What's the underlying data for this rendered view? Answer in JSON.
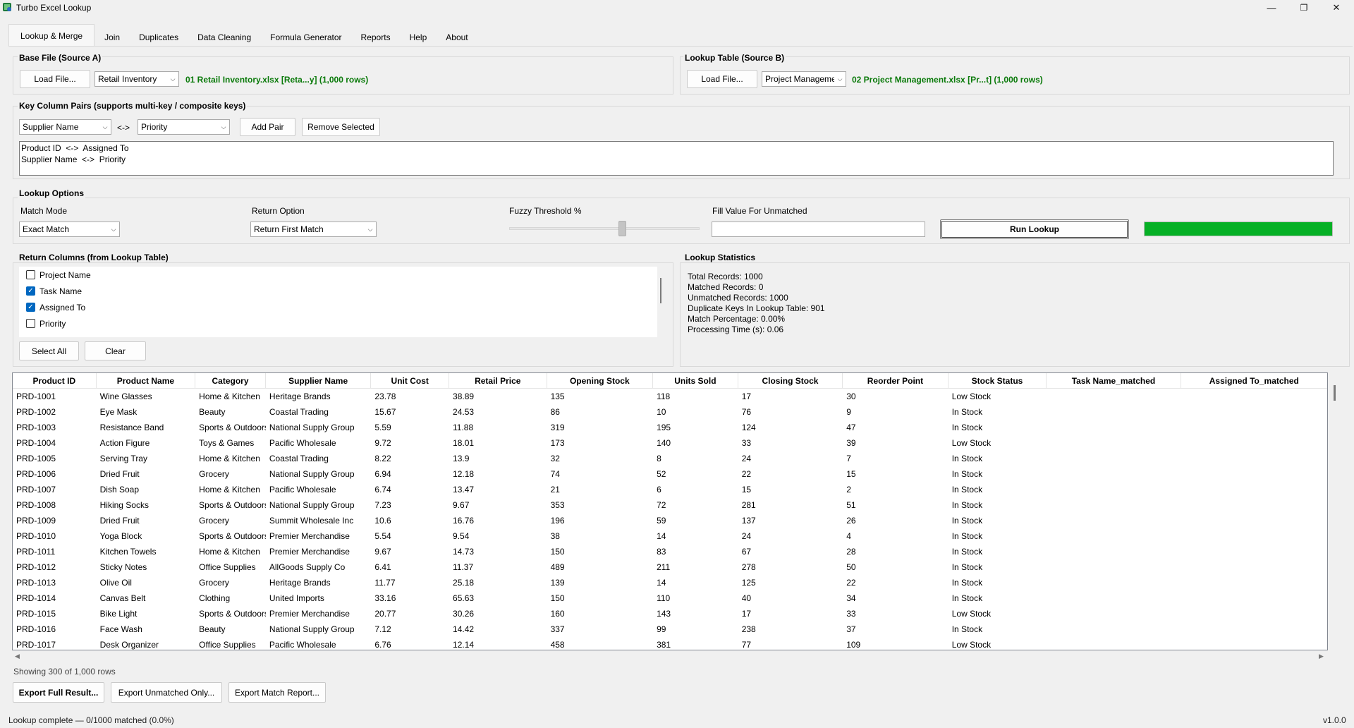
{
  "window": {
    "title": "Turbo Excel Lookup",
    "minimize": "—",
    "maximize": "❐",
    "close": "✕"
  },
  "tabs": [
    {
      "label": "Lookup & Merge",
      "active": true
    },
    {
      "label": "Join"
    },
    {
      "label": "Duplicates"
    },
    {
      "label": "Data Cleaning"
    },
    {
      "label": "Formula Generator"
    },
    {
      "label": "Reports"
    },
    {
      "label": "Help"
    },
    {
      "label": "About"
    }
  ],
  "base_file": {
    "title": "Base File (Source A)",
    "load_label": "Load File...",
    "sheet": "Retail Inventory",
    "file_info": "01 Retail Inventory.xlsx  [Reta...y]  (1,000 rows)"
  },
  "lookup_table": {
    "title": "Lookup Table (Source B)",
    "load_label": "Load File...",
    "sheet": "Project Management",
    "file_info": "02 Project Management.xlsx  [Pr...t]  (1,000 rows)"
  },
  "key_pairs": {
    "title": "Key Column Pairs  (supports multi-key / composite keys)",
    "left_col": "Supplier Name",
    "separator": "<->",
    "right_col": "Priority",
    "add_label": "Add Pair",
    "remove_label": "Remove Selected",
    "pairs": [
      "Product ID  <->  Assigned To",
      "Supplier Name  <->  Priority"
    ]
  },
  "options": {
    "title": "Lookup Options",
    "match_mode_label": "Match Mode",
    "match_mode": "Exact Match",
    "return_option_label": "Return Option",
    "return_option": "Return First Match",
    "fuzzy_label": "Fuzzy Threshold %",
    "fuzzy_value": 0.6,
    "fill_label": "Fill Value For Unmatched",
    "fill_value": "",
    "run_label": "Run Lookup",
    "progress": 1.0
  },
  "return_columns": {
    "title": "Return Columns (from Lookup Table)",
    "items": [
      {
        "label": "Project Name",
        "checked": false
      },
      {
        "label": "Task Name",
        "checked": true
      },
      {
        "label": "Assigned To",
        "checked": true
      },
      {
        "label": "Priority",
        "checked": false
      }
    ],
    "select_all_label": "Select All",
    "clear_label": "Clear"
  },
  "stats": {
    "title": "Lookup Statistics",
    "lines": [
      "Total Records: 1000",
      "Matched Records: 0",
      "Unmatched Records: 1000",
      "Duplicate Keys In Lookup Table: 901",
      "Match Percentage: 0.00%",
      "Processing Time (s): 0.06"
    ]
  },
  "table": {
    "columns": [
      "Product ID",
      "Product Name",
      "Category",
      "Supplier Name",
      "Unit Cost",
      "Retail Price",
      "Opening Stock",
      "Units Sold",
      "Closing Stock",
      "Reorder Point",
      "Stock Status",
      "Task Name_matched",
      "Assigned To_matched"
    ],
    "rows": [
      [
        "PRD-1001",
        "Wine Glasses",
        "Home & Kitchen",
        "Heritage Brands",
        "23.78",
        "38.89",
        "135",
        "118",
        "17",
        "30",
        "Low Stock",
        "",
        ""
      ],
      [
        "PRD-1002",
        "Eye Mask",
        "Beauty",
        "Coastal Trading",
        "15.67",
        "24.53",
        "86",
        "10",
        "76",
        "9",
        "In Stock",
        "",
        ""
      ],
      [
        "PRD-1003",
        "Resistance Band",
        "Sports & Outdoors",
        "National Supply Group",
        "5.59",
        "11.88",
        "319",
        "195",
        "124",
        "47",
        "In Stock",
        "",
        ""
      ],
      [
        "PRD-1004",
        "Action Figure",
        "Toys & Games",
        "Pacific Wholesale",
        "9.72",
        "18.01",
        "173",
        "140",
        "33",
        "39",
        "Low Stock",
        "",
        ""
      ],
      [
        "PRD-1005",
        "Serving Tray",
        "Home & Kitchen",
        "Coastal Trading",
        "8.22",
        "13.9",
        "32",
        "8",
        "24",
        "7",
        "In Stock",
        "",
        ""
      ],
      [
        "PRD-1006",
        "Dried Fruit",
        "Grocery",
        "National Supply Group",
        "6.94",
        "12.18",
        "74",
        "52",
        "22",
        "15",
        "In Stock",
        "",
        ""
      ],
      [
        "PRD-1007",
        "Dish Soap",
        "Home & Kitchen",
        "Pacific Wholesale",
        "6.74",
        "13.47",
        "21",
        "6",
        "15",
        "2",
        "In Stock",
        "",
        ""
      ],
      [
        "PRD-1008",
        "Hiking Socks",
        "Sports & Outdoors",
        "National Supply Group",
        "7.23",
        "9.67",
        "353",
        "72",
        "281",
        "51",
        "In Stock",
        "",
        ""
      ],
      [
        "PRD-1009",
        "Dried Fruit",
        "Grocery",
        "Summit Wholesale Inc",
        "10.6",
        "16.76",
        "196",
        "59",
        "137",
        "26",
        "In Stock",
        "",
        ""
      ],
      [
        "PRD-1010",
        "Yoga Block",
        "Sports & Outdoors",
        "Premier Merchandise",
        "5.54",
        "9.54",
        "38",
        "14",
        "24",
        "4",
        "In Stock",
        "",
        ""
      ],
      [
        "PRD-1011",
        "Kitchen Towels",
        "Home & Kitchen",
        "Premier Merchandise",
        "9.67",
        "14.73",
        "150",
        "83",
        "67",
        "28",
        "In Stock",
        "",
        ""
      ],
      [
        "PRD-1012",
        "Sticky Notes",
        "Office Supplies",
        "AllGoods Supply Co",
        "6.41",
        "11.37",
        "489",
        "211",
        "278",
        "50",
        "In Stock",
        "",
        ""
      ],
      [
        "PRD-1013",
        "Olive Oil",
        "Grocery",
        "Heritage Brands",
        "11.77",
        "25.18",
        "139",
        "14",
        "125",
        "22",
        "In Stock",
        "",
        ""
      ],
      [
        "PRD-1014",
        "Canvas Belt",
        "Clothing",
        "United Imports",
        "33.16",
        "65.63",
        "150",
        "110",
        "40",
        "34",
        "In Stock",
        "",
        ""
      ],
      [
        "PRD-1015",
        "Bike Light",
        "Sports & Outdoors",
        "Premier Merchandise",
        "20.77",
        "30.26",
        "160",
        "143",
        "17",
        "33",
        "Low Stock",
        "",
        ""
      ],
      [
        "PRD-1016",
        "Face Wash",
        "Beauty",
        "National Supply Group",
        "7.12",
        "14.42",
        "337",
        "99",
        "238",
        "37",
        "In Stock",
        "",
        ""
      ],
      [
        "PRD-1017",
        "Desk Organizer",
        "Office Supplies",
        "Pacific Wholesale",
        "6.76",
        "12.14",
        "458",
        "381",
        "77",
        "109",
        "Low Stock",
        "",
        ""
      ]
    ],
    "showing": "Showing 300 of 1,000 rows"
  },
  "exports": {
    "full": "Export Full Result...",
    "unmatched": "Export Unmatched Only...",
    "report": "Export Match Report..."
  },
  "status": {
    "text": "Lookup complete — 0/1000 matched (0.0%)",
    "version": "v1.0.0"
  },
  "colors": {
    "accent_green": "#0a7a0a",
    "progress_green": "#06b025",
    "checkbox_blue": "#0067c0"
  }
}
